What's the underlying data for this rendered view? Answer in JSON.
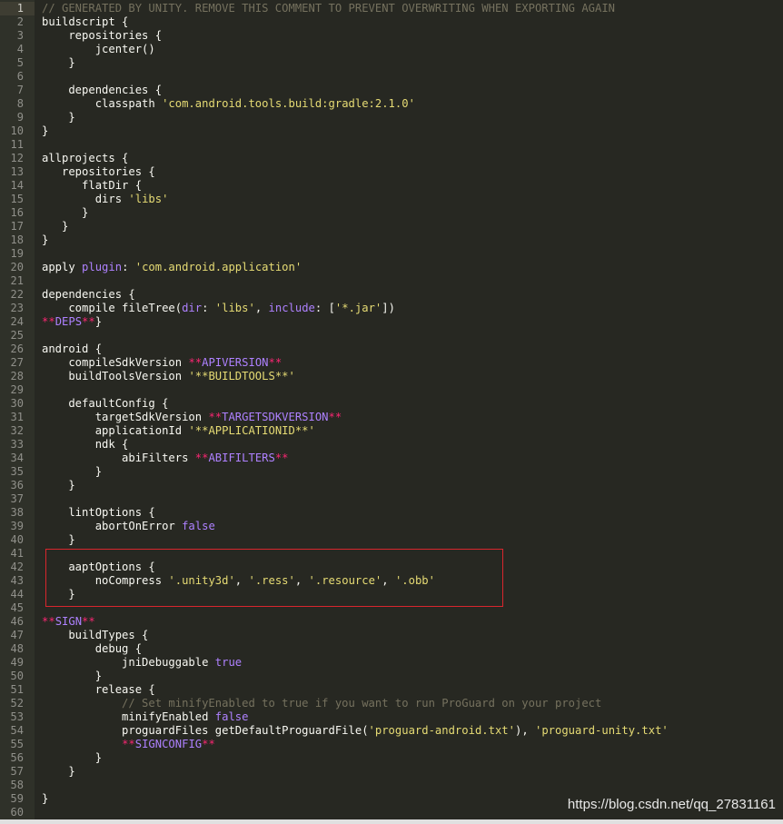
{
  "editor": {
    "current_line": 1,
    "highlighted_lines": [
      41,
      45
    ],
    "colors": {
      "background": "#272822",
      "comment": "#75715e",
      "string": "#e6db74",
      "keyword": "#ae81ff",
      "placeholder": "#f92672",
      "highlight_box": "#d9262d"
    },
    "lines": [
      {
        "n": "1",
        "t": [
          [
            "cm",
            "// GENERATED BY UNITY. REMOVE THIS COMMENT TO PREVENT OVERWRITING WHEN EXPORTING AGAIN"
          ]
        ]
      },
      {
        "n": "2",
        "t": [
          [
            "",
            "buildscript {"
          ]
        ]
      },
      {
        "n": "3",
        "t": [
          [
            "",
            "    repositories {"
          ]
        ]
      },
      {
        "n": "4",
        "t": [
          [
            "",
            "        jcenter()"
          ]
        ]
      },
      {
        "n": "5",
        "t": [
          [
            "",
            "    }"
          ]
        ]
      },
      {
        "n": "6",
        "t": []
      },
      {
        "n": "7",
        "t": [
          [
            "",
            "    dependencies {"
          ]
        ]
      },
      {
        "n": "8",
        "t": [
          [
            "",
            "        classpath "
          ],
          [
            "str",
            "'com.android.tools.build:gradle:2.1.0'"
          ]
        ]
      },
      {
        "n": "9",
        "t": [
          [
            "",
            "    }"
          ]
        ]
      },
      {
        "n": "10",
        "t": [
          [
            "",
            "}"
          ]
        ]
      },
      {
        "n": "11",
        "t": []
      },
      {
        "n": "12",
        "t": [
          [
            "",
            "allprojects {"
          ]
        ]
      },
      {
        "n": "13",
        "t": [
          [
            "",
            "   repositories {"
          ]
        ]
      },
      {
        "n": "14",
        "t": [
          [
            "",
            "      flatDir {"
          ]
        ]
      },
      {
        "n": "15",
        "t": [
          [
            "",
            "        dirs "
          ],
          [
            "str",
            "'libs'"
          ]
        ]
      },
      {
        "n": "16",
        "t": [
          [
            "",
            "      }"
          ]
        ]
      },
      {
        "n": "17",
        "t": [
          [
            "",
            "   }"
          ]
        ]
      },
      {
        "n": "18",
        "t": [
          [
            "",
            "}"
          ]
        ]
      },
      {
        "n": "19",
        "t": []
      },
      {
        "n": "20",
        "t": [
          [
            "",
            "apply "
          ],
          [
            "kw",
            "plugin"
          ],
          [
            "",
            ": "
          ],
          [
            "str",
            "'com.android.application'"
          ]
        ]
      },
      {
        "n": "21",
        "t": []
      },
      {
        "n": "22",
        "t": [
          [
            "",
            "dependencies {"
          ]
        ]
      },
      {
        "n": "23",
        "t": [
          [
            "",
            "    compile fileTree("
          ],
          [
            "kw",
            "dir"
          ],
          [
            "",
            ": "
          ],
          [
            "str",
            "'libs'"
          ],
          [
            "",
            ", "
          ],
          [
            "kw",
            "include"
          ],
          [
            "",
            ": ["
          ],
          [
            "str",
            "'*.jar'"
          ],
          [
            "",
            "])"
          ]
        ]
      },
      {
        "n": "24",
        "t": [
          [
            "ph",
            "**"
          ],
          [
            "ph2",
            "DEPS"
          ],
          [
            "ph",
            "**"
          ],
          [
            "",
            "}"
          ]
        ]
      },
      {
        "n": "25",
        "t": []
      },
      {
        "n": "26",
        "t": [
          [
            "",
            "android {"
          ]
        ]
      },
      {
        "n": "27",
        "t": [
          [
            "",
            "    compileSdkVersion "
          ],
          [
            "ph",
            "**"
          ],
          [
            "ph2",
            "APIVERSION"
          ],
          [
            "ph",
            "**"
          ]
        ]
      },
      {
        "n": "28",
        "t": [
          [
            "",
            "    buildToolsVersion "
          ],
          [
            "str",
            "'**BUILDTOOLS**'"
          ]
        ]
      },
      {
        "n": "29",
        "t": []
      },
      {
        "n": "30",
        "t": [
          [
            "",
            "    defaultConfig {"
          ]
        ]
      },
      {
        "n": "31",
        "t": [
          [
            "",
            "        targetSdkVersion "
          ],
          [
            "ph",
            "**"
          ],
          [
            "ph2",
            "TARGETSDKVERSION"
          ],
          [
            "ph",
            "**"
          ]
        ]
      },
      {
        "n": "32",
        "t": [
          [
            "",
            "        applicationId "
          ],
          [
            "str",
            "'**APPLICATIONID**'"
          ]
        ]
      },
      {
        "n": "33",
        "t": [
          [
            "",
            "        ndk {"
          ]
        ]
      },
      {
        "n": "34",
        "t": [
          [
            "",
            "            abiFilters "
          ],
          [
            "ph",
            "**"
          ],
          [
            "ph2",
            "ABIFILTERS"
          ],
          [
            "ph",
            "**"
          ]
        ]
      },
      {
        "n": "35",
        "t": [
          [
            "",
            "        }"
          ]
        ]
      },
      {
        "n": "36",
        "t": [
          [
            "",
            "    }"
          ]
        ]
      },
      {
        "n": "37",
        "t": []
      },
      {
        "n": "38",
        "t": [
          [
            "",
            "    lintOptions {"
          ]
        ]
      },
      {
        "n": "39",
        "t": [
          [
            "",
            "        abortOnError "
          ],
          [
            "kw",
            "false"
          ]
        ]
      },
      {
        "n": "40",
        "t": [
          [
            "",
            "    }"
          ]
        ]
      },
      {
        "n": "41",
        "t": []
      },
      {
        "n": "42",
        "t": [
          [
            "",
            "    aaptOptions {"
          ]
        ]
      },
      {
        "n": "43",
        "t": [
          [
            "",
            "        noCompress "
          ],
          [
            "str",
            "'.unity3d'"
          ],
          [
            "",
            ", "
          ],
          [
            "str",
            "'.ress'"
          ],
          [
            "",
            ", "
          ],
          [
            "str",
            "'.resource'"
          ],
          [
            "",
            ", "
          ],
          [
            "str",
            "'.obb'"
          ]
        ]
      },
      {
        "n": "44",
        "t": [
          [
            "",
            "    }"
          ]
        ]
      },
      {
        "n": "45",
        "t": []
      },
      {
        "n": "46",
        "t": [
          [
            "ph",
            "**"
          ],
          [
            "ph2",
            "SIGN"
          ],
          [
            "ph",
            "**"
          ]
        ]
      },
      {
        "n": "47",
        "t": [
          [
            "",
            "    buildTypes {"
          ]
        ]
      },
      {
        "n": "48",
        "t": [
          [
            "",
            "        debug {"
          ]
        ]
      },
      {
        "n": "49",
        "t": [
          [
            "",
            "            jniDebuggable "
          ],
          [
            "kw",
            "true"
          ]
        ]
      },
      {
        "n": "50",
        "t": [
          [
            "",
            "        }"
          ]
        ]
      },
      {
        "n": "51",
        "t": [
          [
            "",
            "        release {"
          ]
        ]
      },
      {
        "n": "52",
        "t": [
          [
            "cm",
            "            // Set minifyEnabled to true if you want to run ProGuard on your project"
          ]
        ]
      },
      {
        "n": "53",
        "t": [
          [
            "",
            "            minifyEnabled "
          ],
          [
            "kw",
            "false"
          ]
        ]
      },
      {
        "n": "54",
        "t": [
          [
            "",
            "            proguardFiles getDefaultProguardFile("
          ],
          [
            "str",
            "'proguard-android.txt'"
          ],
          [
            "",
            "), "
          ],
          [
            "str",
            "'proguard-unity.txt'"
          ]
        ]
      },
      {
        "n": "55",
        "t": [
          [
            "",
            "            "
          ],
          [
            "ph",
            "**"
          ],
          [
            "ph2",
            "SIGNCONFIG"
          ],
          [
            "ph",
            "**"
          ]
        ]
      },
      {
        "n": "56",
        "t": [
          [
            "",
            "        }"
          ]
        ]
      },
      {
        "n": "57",
        "t": [
          [
            "",
            "    }"
          ]
        ]
      },
      {
        "n": "58",
        "t": []
      },
      {
        "n": "59",
        "t": [
          [
            "",
            "}"
          ]
        ]
      },
      {
        "n": "60",
        "t": []
      }
    ]
  },
  "watermark": {
    "text": "https://blog.csdn.net/qq_27831161"
  }
}
